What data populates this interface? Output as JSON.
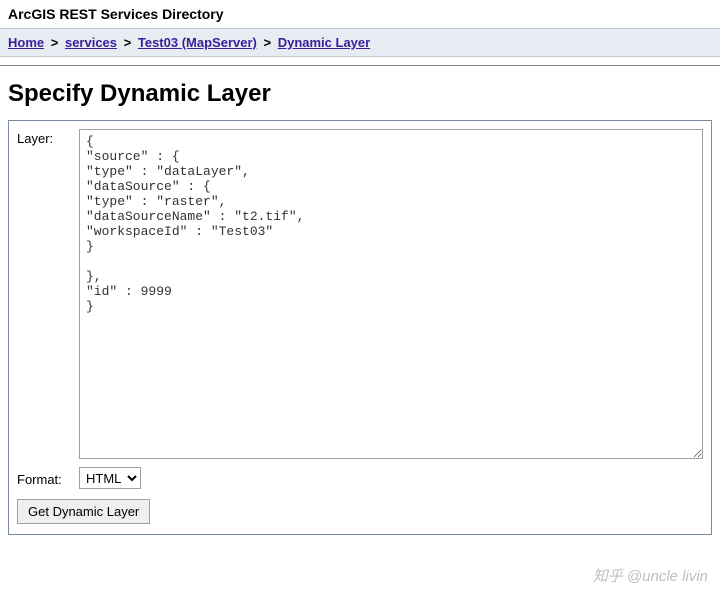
{
  "header": {
    "title": "ArcGIS REST Services Directory"
  },
  "breadcrumb": {
    "items": [
      {
        "label": "Home"
      },
      {
        "label": "services"
      },
      {
        "label": "Test03 (MapServer)"
      },
      {
        "label": "Dynamic Layer"
      }
    ],
    "separator": ">"
  },
  "page": {
    "heading": "Specify Dynamic Layer"
  },
  "form": {
    "layer_label": "Layer:",
    "layer_value": "{\n\"source\" : {\n\"type\" : \"dataLayer\",\n\"dataSource\" : {\n\"type\" : \"raster\",\n\"dataSourceName\" : \"t2.tif\",\n\"workspaceId\" : \"Test03\"\n}\n\n},\n\"id\" : 9999\n}",
    "format_label": "Format:",
    "format_selected": "HTML",
    "submit_label": "Get Dynamic Layer"
  },
  "watermark": "知乎 @uncle livin"
}
